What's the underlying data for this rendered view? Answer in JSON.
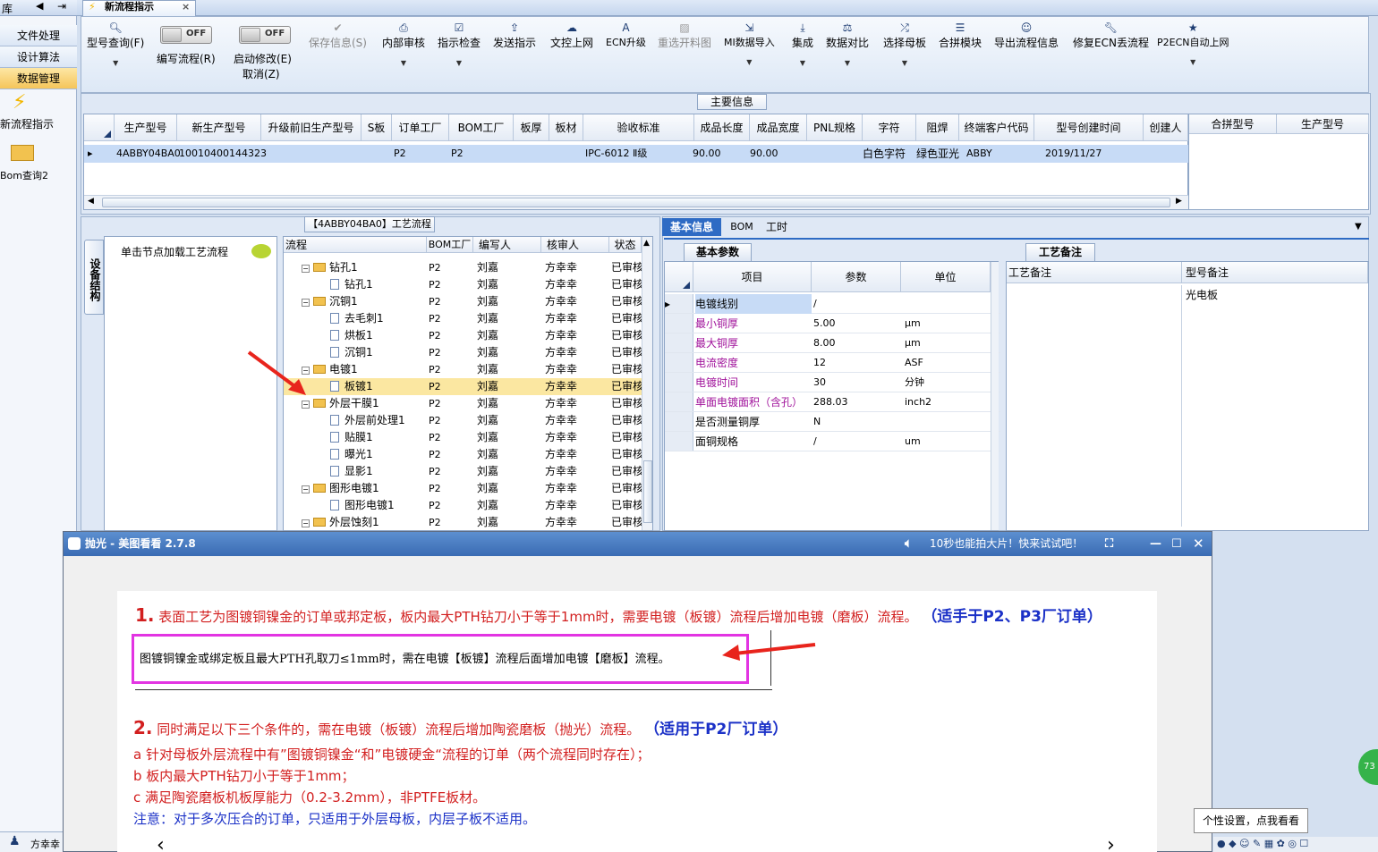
{
  "left_nav": {
    "top_label": "库",
    "items": [
      {
        "label": "文件处理"
      },
      {
        "label": "设计算法"
      },
      {
        "label": "数据管理"
      }
    ],
    "icons": [
      {
        "label": "新流程指示"
      },
      {
        "label": "Bom查询2"
      }
    ],
    "footer_user": "方幸幸"
  },
  "tab": {
    "label": "新流程指示"
  },
  "ribbon": {
    "buttons": [
      {
        "label": "型号查询(F)",
        "icon": "search-icon"
      },
      {
        "label": "编写流程(R)",
        "toggle": "OFF"
      },
      {
        "label": "启动修改(E)",
        "toggle": "OFF",
        "sub": "取消(Z)"
      },
      {
        "label": "保存信息(S)",
        "icon": "check-icon",
        "disabled": true
      },
      {
        "label": "内部审核",
        "icon": "print-icon"
      },
      {
        "label": "指示检查",
        "icon": "checkbox-icon"
      },
      {
        "label": "发送指示",
        "icon": "upload-icon"
      },
      {
        "label": "文控上网",
        "icon": "cloud-upload-icon"
      },
      {
        "label": "ECN升级",
        "icon": "font-icon"
      },
      {
        "label": "重选开料图",
        "icon": "image-icon",
        "disabled": true
      },
      {
        "label": "MI数据导入",
        "icon": "import-icon"
      },
      {
        "label": "集成",
        "icon": "download-icon"
      },
      {
        "label": "数据对比",
        "icon": "compare-icon"
      },
      {
        "label": "选择母板",
        "icon": "shuffle-icon"
      },
      {
        "label": "合拼模块",
        "icon": "list-icon"
      },
      {
        "label": "导出流程信息",
        "icon": "smile-icon"
      },
      {
        "label": "修复ECN丢流程",
        "icon": "wrench-icon"
      },
      {
        "label": "P2ECN自动上网",
        "icon": "star-icon"
      }
    ]
  },
  "main_info": {
    "caption": "主要信息",
    "columns": [
      "生产型号",
      "新生产型号",
      "升级前旧生产型号",
      "S板",
      "订单工厂",
      "BOM工厂",
      "板厚",
      "板材",
      "验收标准",
      "成品长度",
      "成品宽度",
      "PNL规格",
      "字符",
      "阻焊",
      "终端客户代码",
      "型号创建时间",
      "创建人"
    ],
    "row": [
      "4ABBY04BA0",
      "10010400144323",
      "",
      "",
      "P2",
      "P2",
      "",
      "",
      "IPC-6012 Ⅱ级",
      "90.00",
      "90.00",
      "",
      "白色字符",
      "绿色亚光",
      "ABBY",
      "2019/11/27",
      ""
    ],
    "right_columns": [
      "合拼型号",
      "生产型号"
    ]
  },
  "process": {
    "caption": "【4ABBY04BA0】工艺流程",
    "side_tab": "设备结构",
    "hint": "单击节点加载工艺流程",
    "columns": [
      "流程",
      "BOM工厂",
      "编写人",
      "核审人",
      "状态"
    ],
    "rows": [
      {
        "name": "钻孔1",
        "level": 0,
        "factory": "P2",
        "writer": "刘嘉",
        "reviewer": "方幸幸",
        "status": "已审核"
      },
      {
        "name": "钻孔1",
        "level": 1,
        "factory": "P2",
        "writer": "刘嘉",
        "reviewer": "方幸幸",
        "status": "已审核"
      },
      {
        "name": "沉铜1",
        "level": 0,
        "factory": "P2",
        "writer": "刘嘉",
        "reviewer": "方幸幸",
        "status": "已审核"
      },
      {
        "name": "去毛刺1",
        "level": 1,
        "factory": "P2",
        "writer": "刘嘉",
        "reviewer": "方幸幸",
        "status": "已审核"
      },
      {
        "name": "烘板1",
        "level": 1,
        "factory": "P2",
        "writer": "刘嘉",
        "reviewer": "方幸幸",
        "status": "已审核"
      },
      {
        "name": "沉铜1",
        "level": 1,
        "factory": "P2",
        "writer": "刘嘉",
        "reviewer": "方幸幸",
        "status": "已审核"
      },
      {
        "name": "电镀1",
        "level": 0,
        "factory": "P2",
        "writer": "刘嘉",
        "reviewer": "方幸幸",
        "status": "已审核"
      },
      {
        "name": "板镀1",
        "level": 1,
        "factory": "P2",
        "writer": "刘嘉",
        "reviewer": "方幸幸",
        "status": "已审核",
        "selected": true
      },
      {
        "name": "外层干膜1",
        "level": 0,
        "factory": "P2",
        "writer": "刘嘉",
        "reviewer": "方幸幸",
        "status": "已审核"
      },
      {
        "name": "外层前处理1",
        "level": 1,
        "factory": "P2",
        "writer": "刘嘉",
        "reviewer": "方幸幸",
        "status": "已审核"
      },
      {
        "name": "贴膜1",
        "level": 1,
        "factory": "P2",
        "writer": "刘嘉",
        "reviewer": "方幸幸",
        "status": "已审核"
      },
      {
        "name": "曝光1",
        "level": 1,
        "factory": "P2",
        "writer": "刘嘉",
        "reviewer": "方幸幸",
        "status": "已审核"
      },
      {
        "name": "显影1",
        "level": 1,
        "factory": "P2",
        "writer": "刘嘉",
        "reviewer": "方幸幸",
        "status": "已审核"
      },
      {
        "name": "图形电镀1",
        "level": 0,
        "factory": "P2",
        "writer": "刘嘉",
        "reviewer": "方幸幸",
        "status": "已审核"
      },
      {
        "name": "图形电镀1",
        "level": 1,
        "factory": "P2",
        "writer": "刘嘉",
        "reviewer": "方幸幸",
        "status": "已审核"
      },
      {
        "name": "外层蚀刻1",
        "level": 0,
        "factory": "P2",
        "writer": "刘嘉",
        "reviewer": "方幸幸",
        "status": "已审核"
      }
    ]
  },
  "details": {
    "tabs": [
      "基本信息",
      "BOM",
      "工时"
    ],
    "sub_tab": "基本参数",
    "columns": [
      "项目",
      "参数",
      "单位"
    ],
    "rows": [
      {
        "item": "电镀线别",
        "value": "/",
        "unit": "",
        "highlight": false
      },
      {
        "item": "最小铜厚",
        "value": "5.00",
        "unit": "μm",
        "highlight": true
      },
      {
        "item": "最大铜厚",
        "value": "8.00",
        "unit": "μm",
        "highlight": true
      },
      {
        "item": "电流密度",
        "value": "12",
        "unit": "ASF",
        "highlight": true
      },
      {
        "item": "电镀时间",
        "value": "30",
        "unit": "分钟",
        "highlight": true
      },
      {
        "item": "单面电镀面积（含孔）",
        "value": "288.03",
        "unit": "inch2",
        "highlight": true
      },
      {
        "item": "是否测量铜厚",
        "value": "N",
        "unit": "",
        "highlight": false
      },
      {
        "item": "面铜规格",
        "value": "/",
        "unit": "um",
        "highlight": false
      }
    ]
  },
  "remarks": {
    "tab": "工艺备注",
    "columns": [
      "工艺备注",
      "型号备注"
    ],
    "model_remark": "光电板"
  },
  "viewer": {
    "title": "抛光 - 美图看看 2.7.8",
    "promo": "10秒也能拍大片！快来试试吧！",
    "rule1_num": "1.",
    "rule1_text": "表面工艺为图镀铜镍金的订单或邦定板，板内最大PTH钻刀小于等于1mm时，需要电镀（板镀）流程后增加电镀（磨板）流程。",
    "rule1_scope": "（适手于P2、P3厂订单）",
    "boxed_note": "图镀铜镍金或绑定板且最大PTH孔取刀≤1mm时，需在电镀【板镀】流程后面增加电镀【磨板】流程。",
    "rule2_num": "2.",
    "rule2_text": "同时满足以下三个条件的，需在电镀（板镀）流程后增加陶瓷磨板（抛光）流程。",
    "rule2_scope": "（适用于P2厂订单）",
    "cond_a": "a  针对母板外层流程中有”图镀铜镍金“和”电镀硬金“流程的订单（两个流程同时存在）；",
    "cond_b": "b  板内最大PTH钻刀小于等于1mm；",
    "cond_c": "c  满足陶瓷磨板机板厚能力（0.2-3.2mm），非PTFE板材。",
    "note": "注意：对于多次压合的订单，只适用于外层母板，内层子板不适用。"
  },
  "popup": {
    "label": "个性设置，点我看看"
  },
  "badge": {
    "label": "73"
  }
}
